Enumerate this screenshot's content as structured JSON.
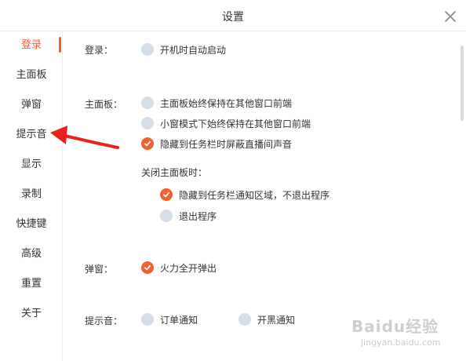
{
  "window": {
    "title": "设置"
  },
  "sidebar": {
    "items": [
      {
        "label": "登录",
        "active": true
      },
      {
        "label": "主面板"
      },
      {
        "label": "弹窗"
      },
      {
        "label": "提示音"
      },
      {
        "label": "显示"
      },
      {
        "label": "录制"
      },
      {
        "label": "快捷键"
      },
      {
        "label": "高级"
      },
      {
        "label": "重置"
      },
      {
        "label": "关于"
      }
    ]
  },
  "login": {
    "label": "登录：",
    "options": [
      {
        "label": "开机时自动启动",
        "checked": false
      }
    ]
  },
  "main_panel": {
    "label": "主面板：",
    "options": [
      {
        "label": "主面板始终保持在其他窗口前端",
        "checked": false
      },
      {
        "label": "小窗模式下始终保持在其他窗口前端",
        "checked": false
      },
      {
        "label": "隐藏到任务栏时屏蔽直播间声音",
        "checked": true
      }
    ],
    "close_label": "关闭主面板时：",
    "close_options": [
      {
        "label": "隐藏到任务栏通知区域，不退出程序",
        "selected": true
      },
      {
        "label": "退出程序",
        "selected": false
      }
    ]
  },
  "popup": {
    "label": "弹窗：",
    "options": [
      {
        "label": "火力全开弹出",
        "checked": true
      }
    ]
  },
  "sound": {
    "label": "提示音：",
    "options": [
      {
        "label": "订单通知",
        "checked": false
      },
      {
        "label": "开黑通知",
        "checked": false
      }
    ]
  },
  "watermark": {
    "brand": "Baidu经验",
    "url": "jingyan.baidu.com"
  },
  "colors": {
    "accent": "#f0612d",
    "radio_off": "#d5dde9",
    "annotation_arrow": "#e8231c"
  },
  "icons": {
    "close": "close-icon",
    "check": "check-icon"
  }
}
